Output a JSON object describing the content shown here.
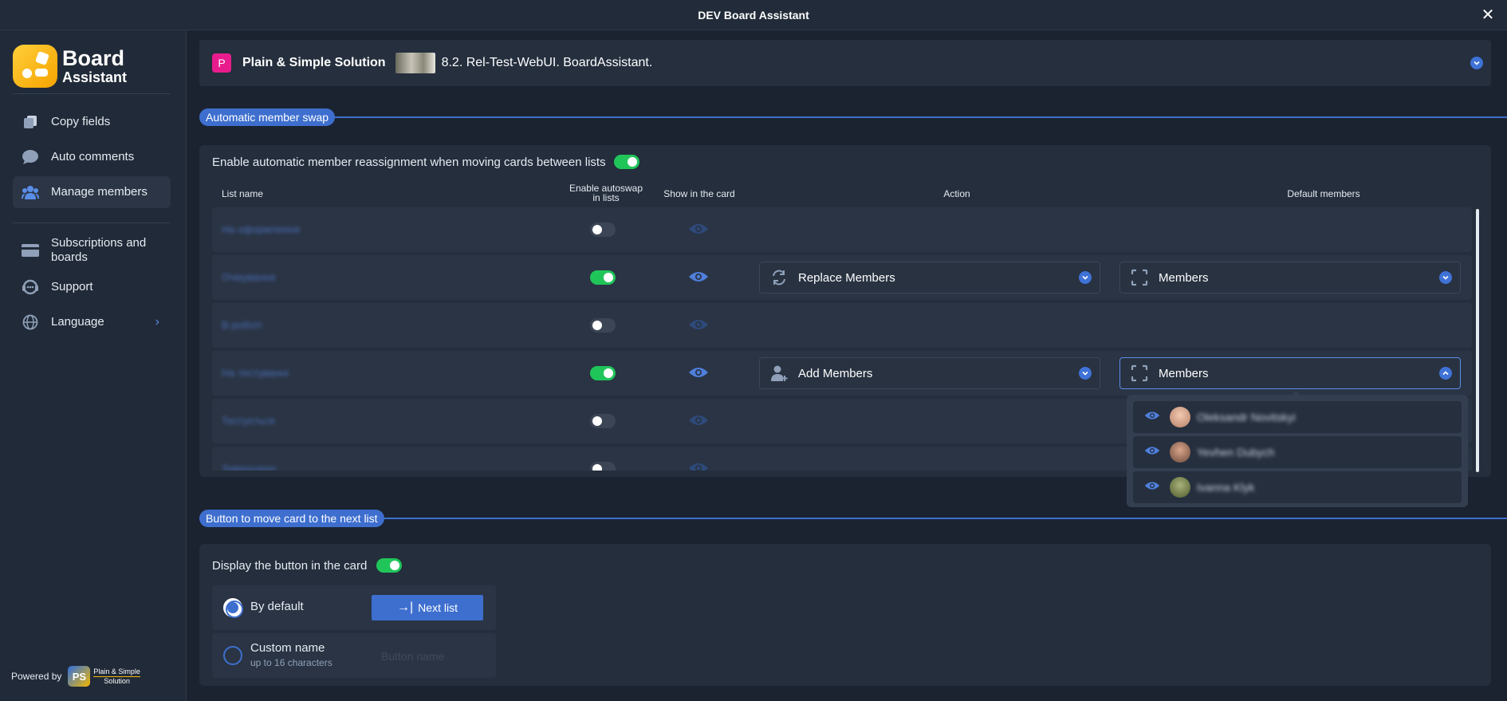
{
  "window": {
    "title": "DEV Board Assistant"
  },
  "sidebar": {
    "logo": {
      "line1": "Board",
      "line2": "Assistant"
    },
    "items": [
      {
        "label": "Copy fields",
        "icon": "copy-icon"
      },
      {
        "label": "Auto comments",
        "icon": "comment-icon"
      },
      {
        "label": "Manage members",
        "icon": "members-icon",
        "active": true
      },
      {
        "label": "Subscriptions and boards",
        "icon": "card-icon"
      },
      {
        "label": "Support",
        "icon": "support-icon"
      },
      {
        "label": "Language",
        "icon": "globe-icon"
      }
    ],
    "powered_by": "Powered by",
    "ps_logo": {
      "initials": "PS",
      "name_line1": "Plain & Simple",
      "name_line2": "Solution"
    }
  },
  "board": {
    "workspace_initial": "P",
    "workspace": "Plain & Simple Solution",
    "board_name": "8.2. Rel-Test-WebUI. BoardAssistant."
  },
  "autoswap": {
    "section_title": "Automatic member swap",
    "enable_label": "Enable automatic member reassignment when moving cards between lists",
    "enabled": true,
    "headers": {
      "list_name": "List name",
      "enable_autoswap_line1": "Enable autoswap",
      "enable_autoswap_line2": "in lists",
      "show_in_card": "Show in the card",
      "action": "Action",
      "default_members": "Default members"
    },
    "rows": [
      {
        "name": "На оформлення",
        "enabled": false
      },
      {
        "name": "Очікування",
        "enabled": true,
        "action": "Replace Members",
        "members": "Members"
      },
      {
        "name": "В роботі",
        "enabled": false
      },
      {
        "name": "На тестуванні",
        "enabled": true,
        "action": "Add Members",
        "members": "Members"
      },
      {
        "name": "Тестується",
        "enabled": false
      },
      {
        "name": "Завершено",
        "enabled": false
      }
    ],
    "member_dropdown": [
      {
        "name": "Oleksandr Novitskyi"
      },
      {
        "name": "Yevhen Dubych"
      },
      {
        "name": "Ivanna Klyk"
      }
    ]
  },
  "next_list": {
    "section_title": "Button to move card to the next list",
    "display_label": "Display the button in the card",
    "display_enabled": true,
    "by_default_label": "By default",
    "next_button_label": "Next list",
    "custom_name_label": "Custom name",
    "custom_name_hint": "up to 16 characters",
    "button_name_placeholder": "Button name"
  },
  "colors": {
    "accent": "#3e6fcf",
    "toggle_on": "#20c55a",
    "background": "#1b2330"
  }
}
